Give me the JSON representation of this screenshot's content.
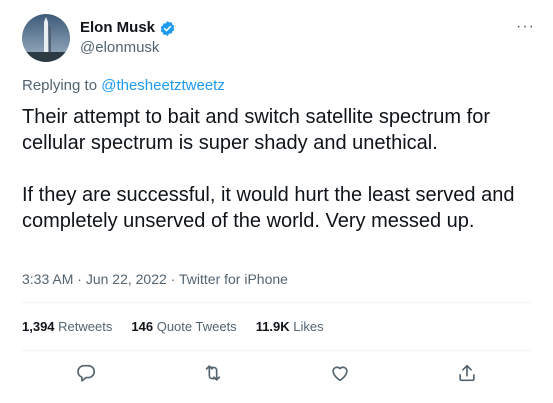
{
  "tweet": {
    "author": {
      "display_name": "Elon Musk",
      "handle": "@elonmusk",
      "verified": true
    },
    "reply_prefix": "Replying to",
    "reply_to": "@thesheetztweetz",
    "text": "Their attempt to bait and switch satellite spectrum for cellular spectrum is super shady and unethical.\n\nIf they are successful, it would hurt the least served and completely unserved of the world. Very messed up.",
    "time": "3:33 AM",
    "date": "Jun 22, 2022",
    "separator": "·",
    "source": "Twitter for iPhone",
    "more_label": "···"
  },
  "stats": {
    "retweets": {
      "count": "1,394",
      "label": "Retweets"
    },
    "quotes": {
      "count": "146",
      "label": "Quote Tweets"
    },
    "likes": {
      "count": "11.9K",
      "label": "Likes"
    }
  },
  "actions": {
    "icons": [
      "reply-icon",
      "retweet-icon",
      "like-icon",
      "share-icon"
    ]
  },
  "colors": {
    "accent": "#1d9bf0",
    "secondary_text": "#536471",
    "divider": "#eff3f4"
  }
}
